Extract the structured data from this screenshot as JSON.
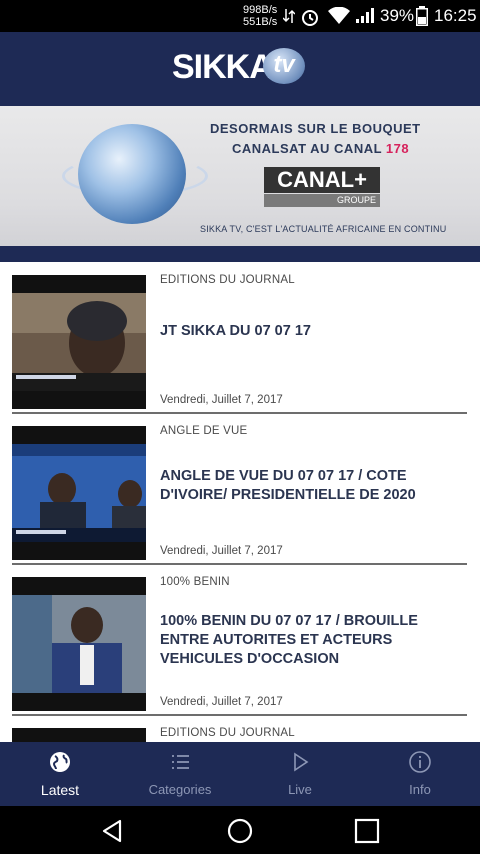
{
  "status_bar": {
    "net_down": "998B/s",
    "net_up": "551B/s",
    "battery": "39%",
    "time": "16:25"
  },
  "header": {
    "logo_text": "SIKKA",
    "logo_tv": "tv"
  },
  "banner": {
    "line1": "DESORMAIS SUR LE BOUQUET",
    "line2_prefix": "CANALSAT AU CANAL ",
    "line2_number": "178",
    "canal_logo": "CANAL+",
    "canal_sub": "GROUPE",
    "footer": "SIKKA TV, C'EST L'ACTUALITÉ AFRICAINE EN CONTINU"
  },
  "feed": [
    {
      "category": "EDITIONS DU JOURNAL",
      "title": "JT SIKKA DU 07 07 17",
      "date": "Vendredi, Juillet 7, 2017"
    },
    {
      "category": "ANGLE DE VUE",
      "title": "ANGLE DE VUE DU 07 07 17 / COTE D'IVOIRE/ PRESIDENTIELLE DE 2020",
      "date": "Vendredi, Juillet 7, 2017"
    },
    {
      "category": "100% BENIN",
      "title": "100% BENIN DU 07 07 17 / BROUILLE ENTRE AUTORITES ET ACTEURS VEHICULES D'OCCASION",
      "date": "Vendredi, Juillet 7, 2017"
    },
    {
      "category": "EDITIONS DU JOURNAL",
      "title": "",
      "date": ""
    }
  ],
  "bottom_nav": [
    {
      "label": "Latest",
      "icon": "globe-icon",
      "active": true
    },
    {
      "label": "Categories",
      "icon": "list-icon",
      "active": false
    },
    {
      "label": "Live",
      "icon": "play-icon",
      "active": false
    },
    {
      "label": "Info",
      "icon": "info-icon",
      "active": false
    }
  ],
  "colors": {
    "brand_navy": "#1e2a55",
    "accent_pink": "#d6225c",
    "inactive_tab": "#8d97b5"
  }
}
